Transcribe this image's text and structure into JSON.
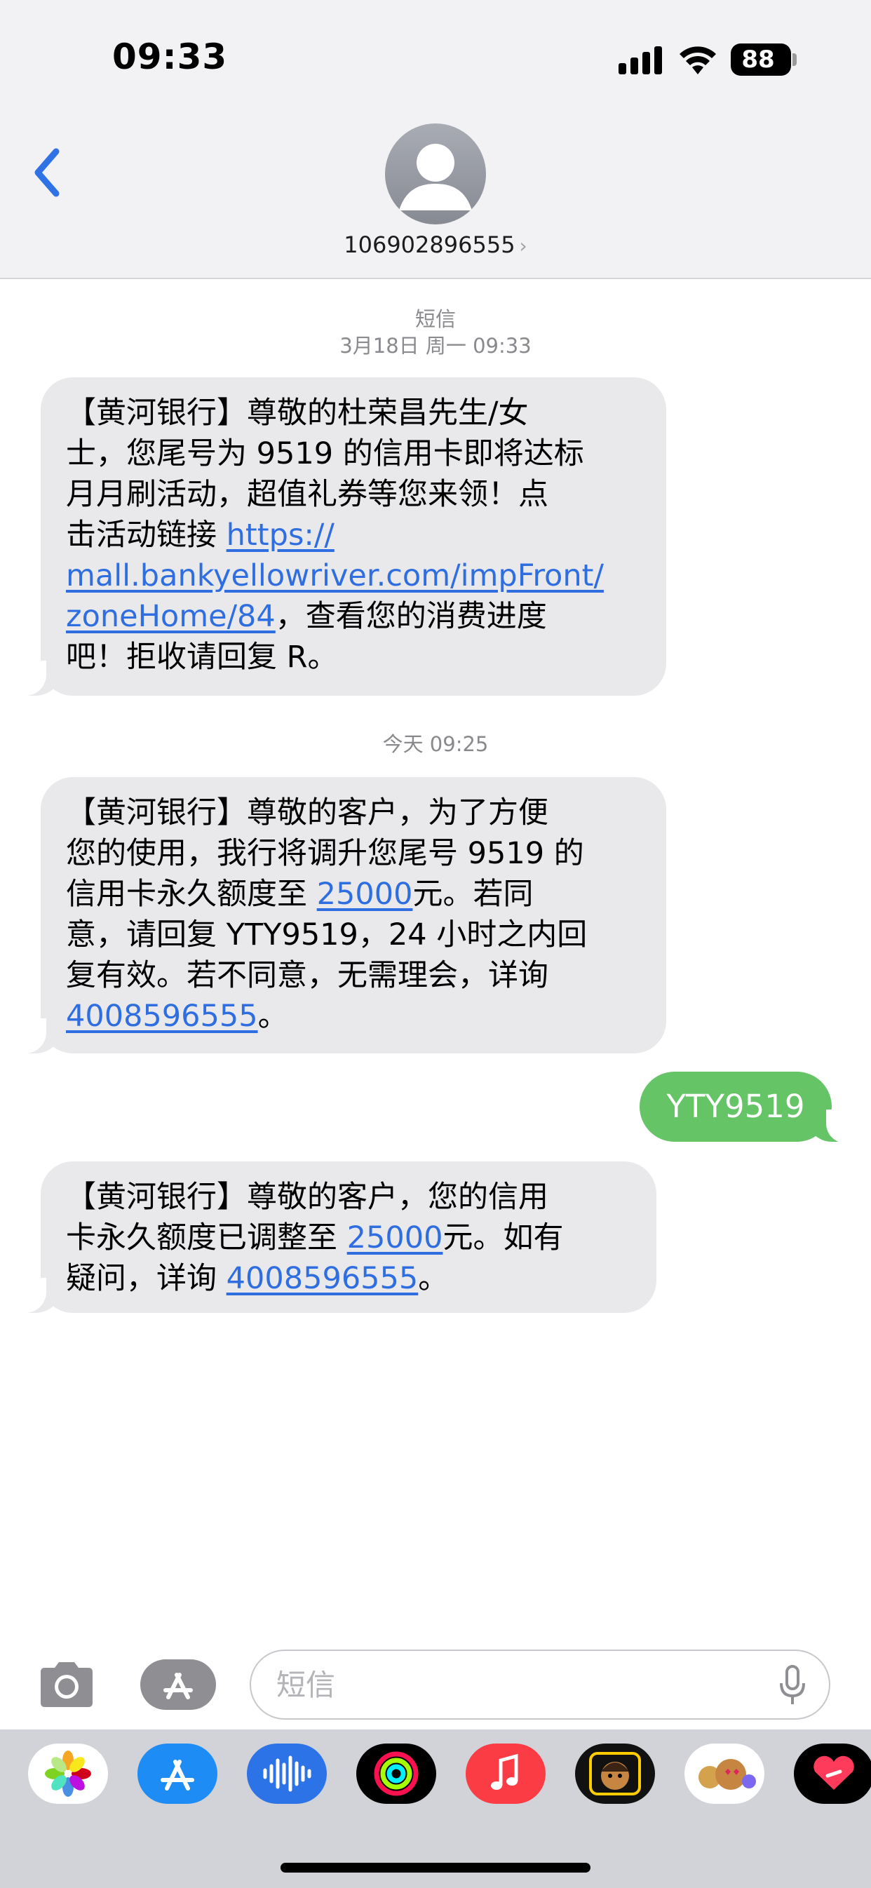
{
  "status_bar": {
    "time": "09:33",
    "battery": "88"
  },
  "header": {
    "contact": "106902896555"
  },
  "messages": [
    {
      "service_label": "短信",
      "timestamp": "3月18日 周一 09:33",
      "lines": [
        {
          "parts": [
            "【黄河银行】尊敬的杜荣昌先生/女"
          ]
        },
        {
          "parts": [
            "士，您尾号为 9519 的信用卡即将达标"
          ]
        },
        {
          "parts": [
            "月月刷活动，超值礼券等您来领！点"
          ]
        },
        {
          "parts": [
            "击活动链接 ",
            "https://"
          ]
        },
        {
          "parts": [
            "mall.bankyellowriver.com/impFront/"
          ]
        },
        {
          "parts": [
            "zoneHome/84",
            "，查看您的消费进度"
          ]
        },
        {
          "parts": [
            "吧！拒收请回复 R。"
          ]
        }
      ]
    },
    {
      "timestamp": "今天 09:25",
      "lines": [
        {
          "parts": [
            "【黄河银行】尊敬的客户，为了方便"
          ]
        },
        {
          "parts": [
            "您的使用，我行将调升您尾号 9519 的"
          ]
        },
        {
          "parts": [
            "信用卡永久额度至 ",
            "25000",
            "元。若同"
          ]
        },
        {
          "parts": [
            "意，请回复 YTY9519，24 小时之内回"
          ]
        },
        {
          "parts": [
            "复有效。若不同意，无需理会，详询"
          ]
        },
        {
          "parts": [
            "4008596555",
            "。"
          ]
        }
      ]
    },
    {
      "outgoing": "YTY9519"
    },
    {
      "lines": [
        {
          "parts": [
            "【黄河银行】尊敬的客户，您的信用"
          ]
        },
        {
          "parts": [
            "卡永久额度已调整至 ",
            "25000",
            "元。如有"
          ]
        },
        {
          "parts": [
            "疑问，详询 ",
            "4008596555",
            "。"
          ]
        }
      ]
    }
  ],
  "input": {
    "placeholder": "短信"
  },
  "app_drawer": {
    "apps": [
      "photos-app-icon",
      "app-store-app-icon",
      "audio-message-app-icon",
      "fitness-rings-app-icon",
      "music-app-icon",
      "memoji-app-icon",
      "animoji-stickers-app-icon",
      "digital-touch-app-icon"
    ]
  },
  "colors": {
    "link": "#2f6ee0",
    "incoming_bubble": "#e9e9eb",
    "outgoing_bubble": "#65c466"
  }
}
